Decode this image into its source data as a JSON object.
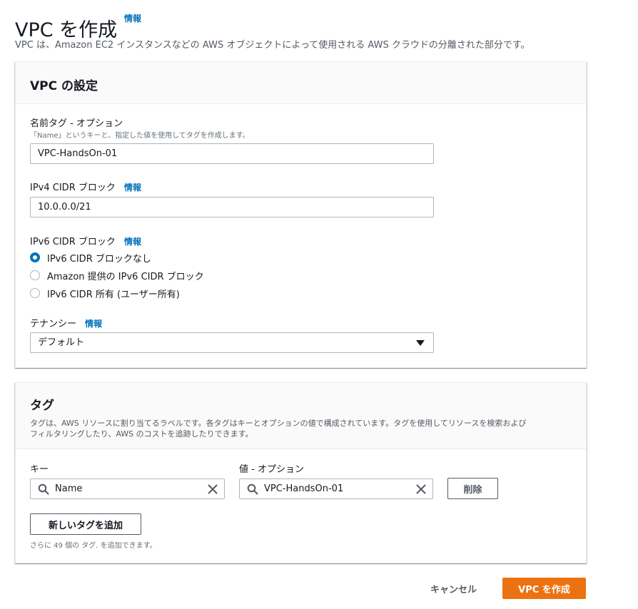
{
  "header": {
    "title": "VPC を作成",
    "info": "情報",
    "description": "VPC は、Amazon EC2 インスタンスなどの AWS オブジェクトによって使用される AWS クラウドの分離された部分です。"
  },
  "vpc_settings": {
    "title": "VPC の設定",
    "name_tag": {
      "label": "名前タグ - オプション",
      "hint": "「Name」というキーと、指定した値を使用してタグを作成します。",
      "value": "VPC-HandsOn-01"
    },
    "ipv4": {
      "label": "IPv4 CIDR ブロック",
      "info": "情報",
      "value": "10.0.0.0/21"
    },
    "ipv6": {
      "label": "IPv6 CIDR ブロック",
      "info": "情報",
      "options": [
        {
          "label": "IPv6 CIDR ブロックなし",
          "checked": true
        },
        {
          "label": "Amazon 提供の IPv6 CIDR ブロック",
          "checked": false
        },
        {
          "label": "IPv6 CIDR 所有 (ユーザー所有)",
          "checked": false
        }
      ]
    },
    "tenancy": {
      "label": "テナンシー",
      "info": "情報",
      "value": "デフォルト"
    }
  },
  "tags": {
    "title": "タグ",
    "description_line1": "タグは、AWS リソースに割り当てるラベルです。各タグはキーとオプションの値で構成されています。タグを使用してリソースを検索および",
    "description_line2": "フィルタリングしたり、AWS のコストを追跡したりできます。",
    "key_label": "キー",
    "value_label": "値 - オプション",
    "rows": [
      {
        "key": "Name",
        "value": "VPC-HandsOn-01",
        "remove_label": "削除"
      }
    ],
    "add_label": "新しいタグを追加",
    "remaining_text": "さらに 49 個の タグ. を追加できます。"
  },
  "footer": {
    "cancel_label": "キャンセル",
    "create_label": "VPC を作成"
  },
  "colors": {
    "accent": "#0073bb",
    "primary_button": "#ec7211"
  }
}
